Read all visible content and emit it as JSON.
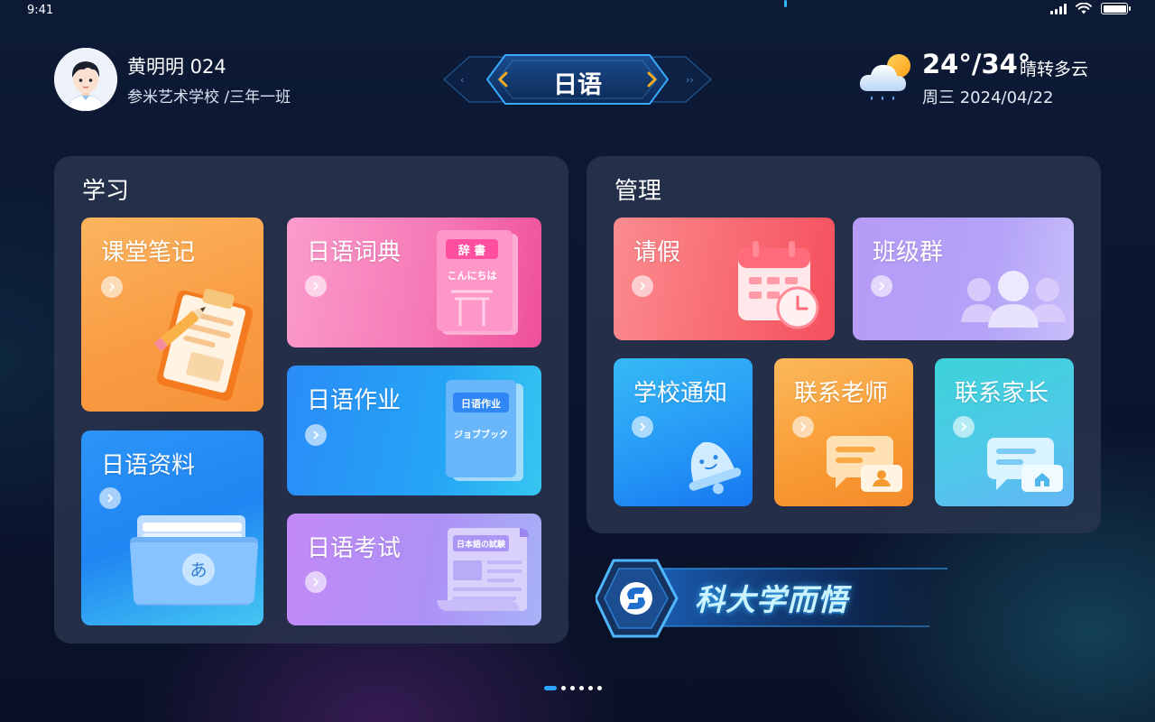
{
  "status_bar": {
    "time": "9:41",
    "icons": [
      "signal-icon",
      "wifi-icon",
      "battery-icon"
    ]
  },
  "profile": {
    "name": "黄明明  024",
    "school": "参米艺术学校 /三年一班"
  },
  "subject_switcher": {
    "label": "日语"
  },
  "weather": {
    "icon": "partly-cloudy-rain-icon",
    "temperature": "24°/34°",
    "description": "晴转多云",
    "date": "周三  2024/04/22"
  },
  "study": {
    "title": "学习",
    "cards": {
      "notes": "课堂笔记",
      "material": "日语资料",
      "dictionary": "日语词典",
      "homework": "日语作业",
      "exam": "日语考试"
    },
    "art_text": {
      "dict_tag": "辞 書",
      "dict_word": "こんにちは",
      "homework_tag": "日语作业",
      "homework_word": "ジョブブック",
      "exam_tag": "日本語の試験",
      "folder_char": "あ"
    }
  },
  "manage": {
    "title": "管理",
    "cards": {
      "leave": "请假",
      "group": "班级群",
      "notice": "学校通知",
      "teacher": "联系老师",
      "parent": "联系家长"
    }
  },
  "banner": {
    "text": "科大学而悟"
  },
  "pager": {
    "count": 6,
    "active": 0
  },
  "colors": {
    "accent": "#2aa4ff",
    "highlight": "#ffb020"
  }
}
